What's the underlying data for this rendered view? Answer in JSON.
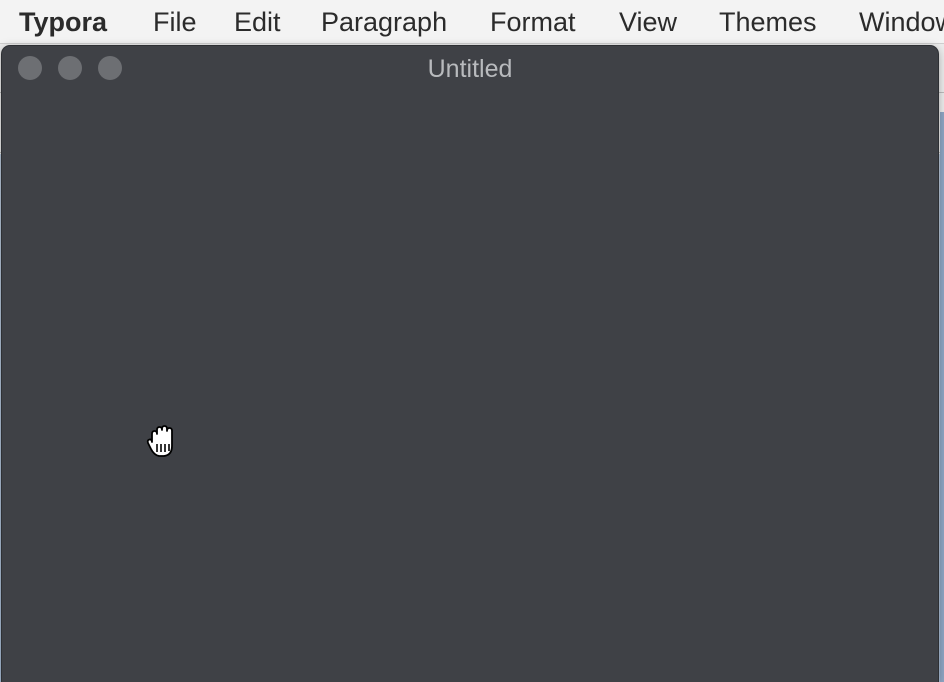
{
  "menubar": {
    "app_name": "Typora",
    "items": [
      "File",
      "Edit",
      "Paragraph",
      "Format",
      "View",
      "Themes",
      "Window"
    ]
  },
  "window": {
    "title": "Untitled",
    "theme_color": "#3f4146"
  },
  "icons": {
    "cursor": "grab-hand-cursor-icon",
    "close": "close-window-icon",
    "minimize": "minimize-window-icon",
    "zoom": "zoom-window-icon"
  }
}
